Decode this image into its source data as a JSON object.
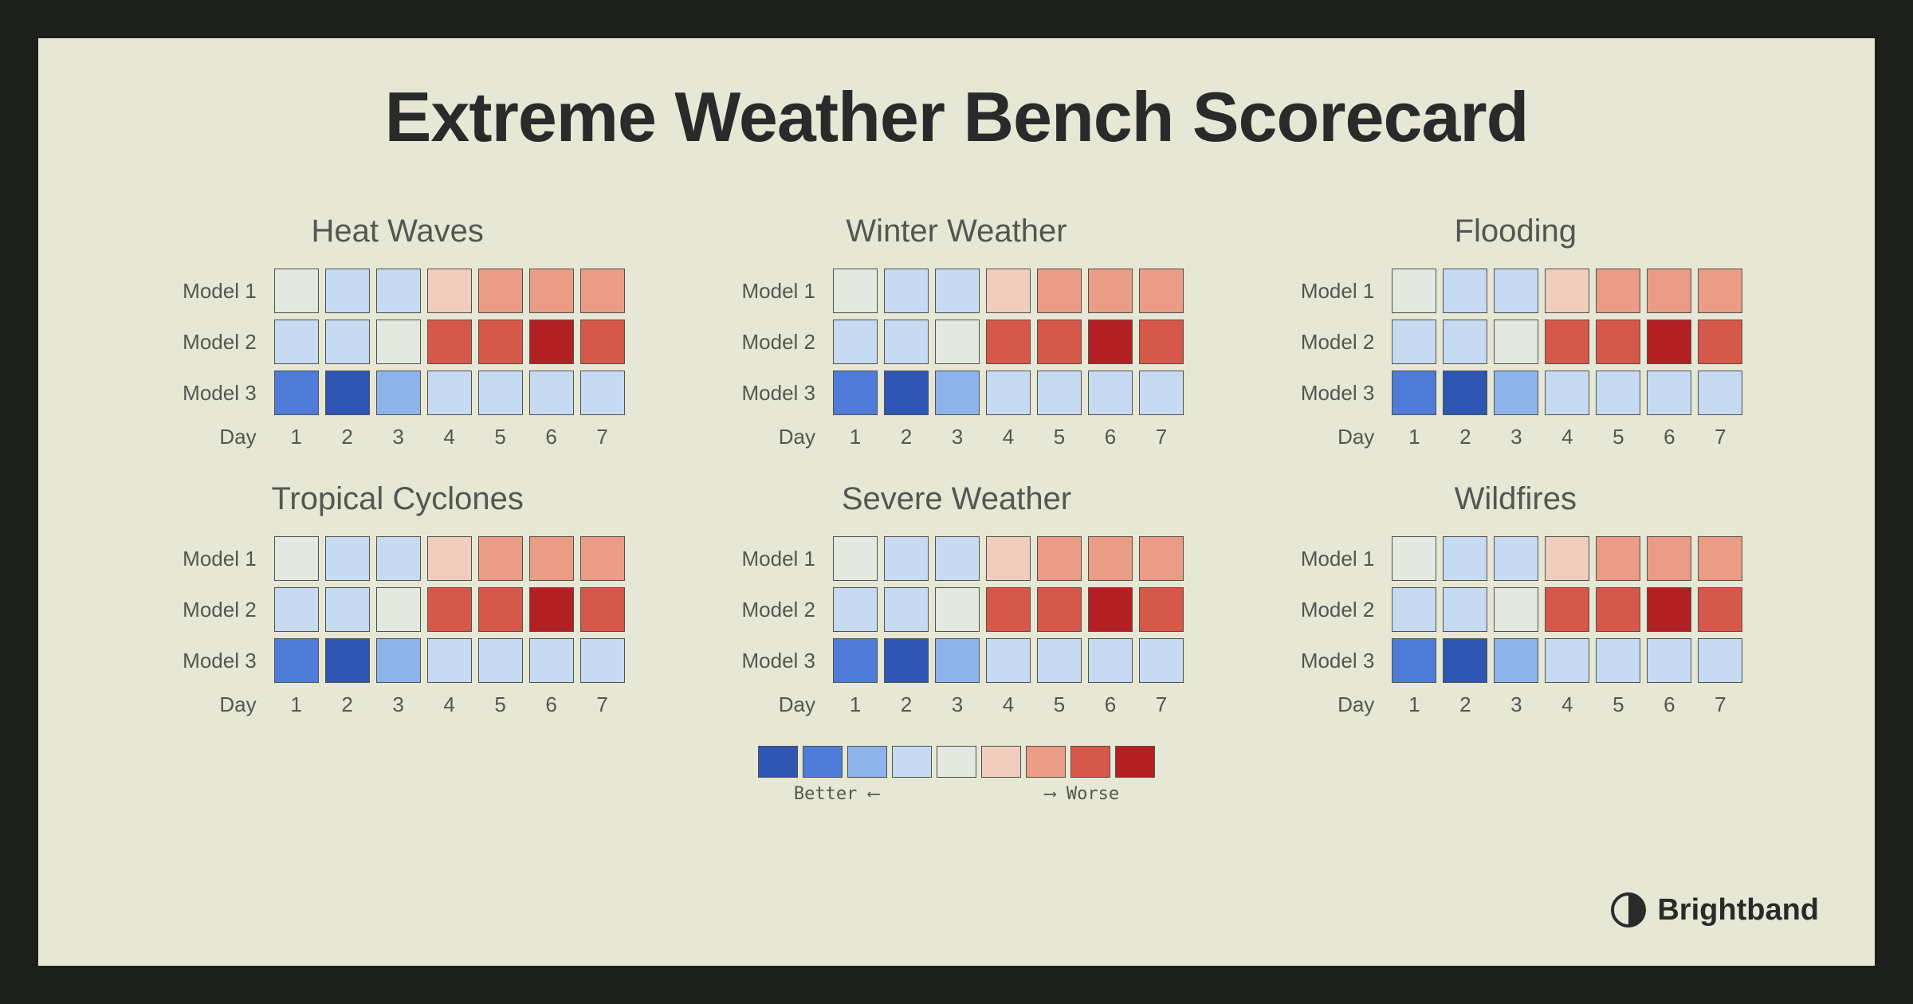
{
  "title": "Extreme Weather Bench Scorecard",
  "brand": "Brightband",
  "row_labels": [
    "Model 1",
    "Model 2",
    "Model 3"
  ],
  "x_label": "Day",
  "x_ticks": [
    "1",
    "2",
    "3",
    "4",
    "5",
    "6",
    "7"
  ],
  "legend": {
    "better": "Better",
    "worse": "Worse"
  },
  "color_scale": [
    "#2f55b5",
    "#4f7cd8",
    "#8eb2ea",
    "#c6daf2",
    "#e3e8e0",
    "#f0cdbe",
    "#eb9c86",
    "#d6584a",
    "#b32024"
  ],
  "panels": [
    {
      "title": "Heat Waves"
    },
    {
      "title": "Winter Weather"
    },
    {
      "title": "Flooding"
    },
    {
      "title": "Tropical Cyclones"
    },
    {
      "title": "Severe Weather"
    },
    {
      "title": "Wildfires"
    }
  ],
  "chart_data": {
    "type": "heatmap",
    "note": "All six panels share identical data in the image.",
    "value_scale": {
      "min": 0,
      "max": 8,
      "meaning": "0=best (deep blue) → 8=worst (deep red); index into color_scale"
    },
    "x": [
      1,
      2,
      3,
      4,
      5,
      6,
      7
    ],
    "y": [
      "Model 1",
      "Model 2",
      "Model 3"
    ],
    "panels": [
      {
        "title": "Heat Waves",
        "z": [
          [
            4,
            3,
            3,
            5,
            6,
            6,
            6
          ],
          [
            3,
            3,
            4,
            7,
            7,
            8,
            7
          ],
          [
            1,
            0,
            2,
            3,
            3,
            3,
            3
          ]
        ]
      },
      {
        "title": "Winter Weather",
        "z": [
          [
            4,
            3,
            3,
            5,
            6,
            6,
            6
          ],
          [
            3,
            3,
            4,
            7,
            7,
            8,
            7
          ],
          [
            1,
            0,
            2,
            3,
            3,
            3,
            3
          ]
        ]
      },
      {
        "title": "Flooding",
        "z": [
          [
            4,
            3,
            3,
            5,
            6,
            6,
            6
          ],
          [
            3,
            3,
            4,
            7,
            7,
            8,
            7
          ],
          [
            1,
            0,
            2,
            3,
            3,
            3,
            3
          ]
        ]
      },
      {
        "title": "Tropical Cyclones",
        "z": [
          [
            4,
            3,
            3,
            5,
            6,
            6,
            6
          ],
          [
            3,
            3,
            4,
            7,
            7,
            8,
            7
          ],
          [
            1,
            0,
            2,
            3,
            3,
            3,
            3
          ]
        ]
      },
      {
        "title": "Severe Weather",
        "z": [
          [
            4,
            3,
            3,
            5,
            6,
            6,
            6
          ],
          [
            3,
            3,
            4,
            7,
            7,
            8,
            7
          ],
          [
            1,
            0,
            2,
            3,
            3,
            3,
            3
          ]
        ]
      },
      {
        "title": "Wildfires",
        "z": [
          [
            4,
            3,
            3,
            5,
            6,
            6,
            6
          ],
          [
            3,
            3,
            4,
            7,
            7,
            8,
            7
          ],
          [
            1,
            0,
            2,
            3,
            3,
            3,
            3
          ]
        ]
      }
    ]
  }
}
